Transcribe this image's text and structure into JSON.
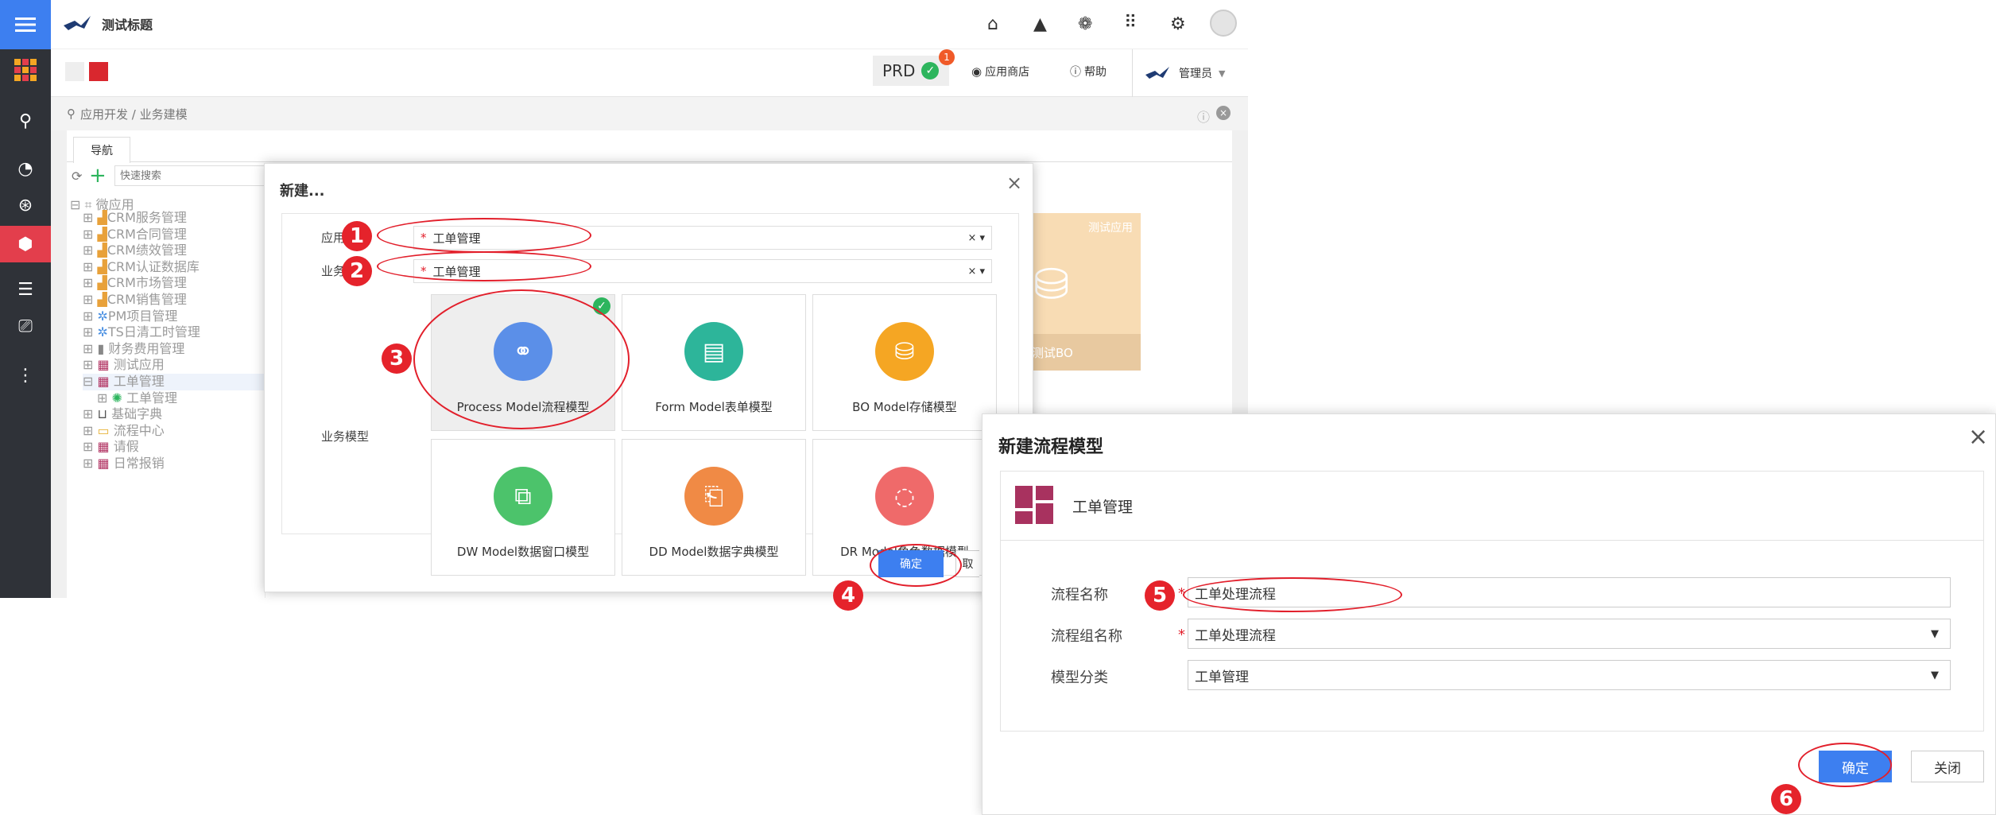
{
  "app": {
    "title": "测试标题"
  },
  "header": {
    "env_label": "PRD",
    "env_badge": "1",
    "app_store": "应用商店",
    "help": "帮助",
    "user": "管理员"
  },
  "breadcrumb": {
    "path": "应用开发 / 业务建模"
  },
  "tabs": [
    {
      "label": "导航"
    }
  ],
  "search": {
    "placeholder": "快速搜索"
  },
  "tree": {
    "root": "微应用",
    "items": [
      "CRM服务管理",
      "CRM合同管理",
      "CRM绩效管理",
      "CRM认证数据库",
      "CRM市场管理",
      "CRM销售管理",
      "PM项目管理",
      "TS日清工时管理",
      "财务费用管理",
      "测试应用",
      "工单管理",
      "工单管理",
      "基础字典",
      "流程中心",
      "请假",
      "日常报销"
    ]
  },
  "background_card": {
    "tag": "测试应用",
    "label": "测试BO"
  },
  "modal_new": {
    "title": "新建...",
    "app_label": "应用",
    "category_label": "业务分类",
    "app_value": "工单管理",
    "category_value": "工单管理",
    "models_label": "业务模型",
    "models": [
      {
        "caption": "Process Model流程模型",
        "color": "#5b8fe8",
        "icon": "flow-icon"
      },
      {
        "caption": "Form Model表单模型",
        "color": "#2db59a",
        "icon": "form-icon"
      },
      {
        "caption": "BO Model存储模型",
        "color": "#f5a623",
        "icon": "database-icon"
      },
      {
        "caption": "DW Model数据窗口模型",
        "color": "#4cc36b",
        "icon": "window-icon"
      },
      {
        "caption": "DD Model数据字典模型",
        "color": "#f08a45",
        "icon": "book-icon"
      },
      {
        "caption": "DR Model角色数据模型",
        "color": "#ef6a6a",
        "icon": "role-icon"
      }
    ],
    "confirm": "确定",
    "cancel": "取"
  },
  "modal_process": {
    "title": "新建流程模型",
    "app_name": "工单管理",
    "fields": [
      {
        "label": "流程名称",
        "value": "工单处理流程"
      },
      {
        "label": "流程组名称",
        "value": "工单处理流程"
      },
      {
        "label": "模型分类",
        "value": "工单管理"
      }
    ],
    "confirm": "确定",
    "close": "关闭"
  },
  "steps": [
    "1",
    "2",
    "3",
    "4",
    "5",
    "6"
  ],
  "colors": {
    "accent": "#3d7ff0",
    "rail": "#2f3238",
    "annotation": "#e21f2b"
  }
}
